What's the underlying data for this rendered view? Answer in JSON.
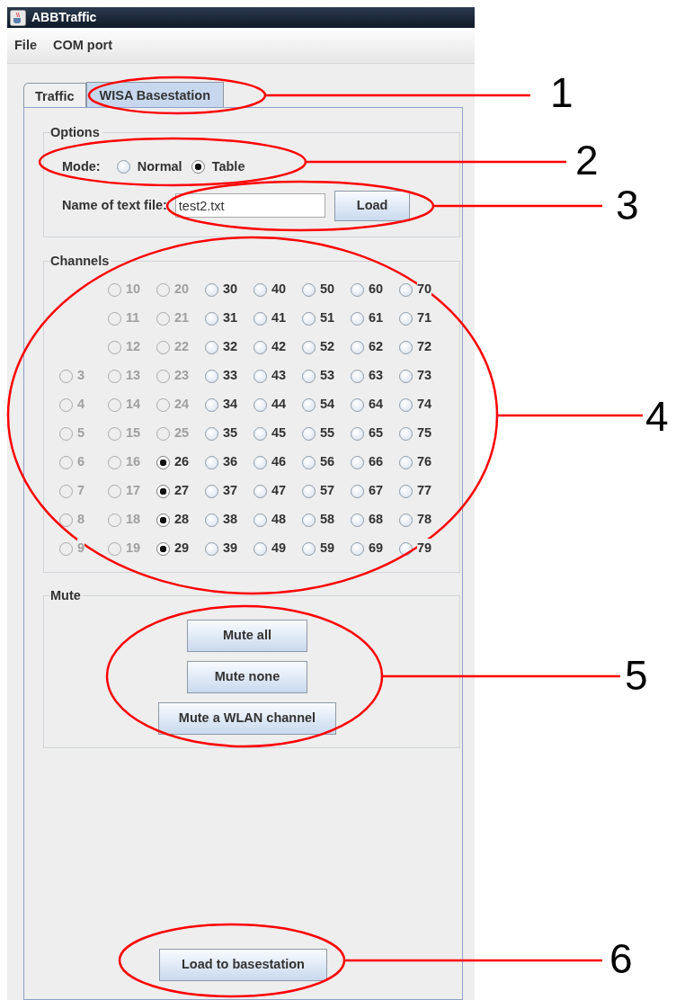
{
  "window": {
    "title": "ABBTraffic"
  },
  "menu": [
    {
      "label": "File"
    },
    {
      "label": "COM port"
    }
  ],
  "tabs": [
    {
      "label": "Traffic",
      "selected": false
    },
    {
      "label": "WISA Basestation",
      "selected": true
    }
  ],
  "options": {
    "title": "Options",
    "mode_label": "Mode:",
    "modes": [
      {
        "label": "Normal",
        "selected": false
      },
      {
        "label": "Table",
        "selected": true
      }
    ],
    "file_label": "Name of text file:",
    "file_value": "test2.txt",
    "load_button": "Load"
  },
  "channels": {
    "title": "Channels",
    "columns": [
      {
        "items": [
          {
            "label": "3",
            "selected": false,
            "disabled": true
          },
          {
            "label": "4",
            "selected": false,
            "disabled": true
          },
          {
            "label": "5",
            "selected": false,
            "disabled": true
          },
          {
            "label": "6",
            "selected": false,
            "disabled": true
          },
          {
            "label": "7",
            "selected": false,
            "disabled": true
          },
          {
            "label": "8",
            "selected": false,
            "disabled": true
          },
          {
            "label": "9",
            "selected": false,
            "disabled": true
          }
        ]
      },
      {
        "items": [
          {
            "label": "10",
            "selected": false,
            "disabled": true
          },
          {
            "label": "11",
            "selected": false,
            "disabled": true
          },
          {
            "label": "12",
            "selected": false,
            "disabled": true
          },
          {
            "label": "13",
            "selected": false,
            "disabled": true
          },
          {
            "label": "14",
            "selected": false,
            "disabled": true
          },
          {
            "label": "15",
            "selected": false,
            "disabled": true
          },
          {
            "label": "16",
            "selected": false,
            "disabled": true
          },
          {
            "label": "17",
            "selected": false,
            "disabled": true
          },
          {
            "label": "18",
            "selected": false,
            "disabled": true
          },
          {
            "label": "19",
            "selected": false,
            "disabled": true
          }
        ]
      },
      {
        "items": [
          {
            "label": "20",
            "selected": false,
            "disabled": true
          },
          {
            "label": "21",
            "selected": false,
            "disabled": true
          },
          {
            "label": "22",
            "selected": false,
            "disabled": true
          },
          {
            "label": "23",
            "selected": false,
            "disabled": true
          },
          {
            "label": "24",
            "selected": false,
            "disabled": true
          },
          {
            "label": "25",
            "selected": false,
            "disabled": true
          },
          {
            "label": "26",
            "selected": true,
            "disabled": false
          },
          {
            "label": "27",
            "selected": true,
            "disabled": false
          },
          {
            "label": "28",
            "selected": true,
            "disabled": false
          },
          {
            "label": "29",
            "selected": true,
            "disabled": false
          }
        ]
      },
      {
        "items": [
          {
            "label": "30",
            "selected": false,
            "disabled": false
          },
          {
            "label": "31",
            "selected": false,
            "disabled": false
          },
          {
            "label": "32",
            "selected": false,
            "disabled": false
          },
          {
            "label": "33",
            "selected": false,
            "disabled": false
          },
          {
            "label": "34",
            "selected": false,
            "disabled": false
          },
          {
            "label": "35",
            "selected": false,
            "disabled": false
          },
          {
            "label": "36",
            "selected": false,
            "disabled": false
          },
          {
            "label": "37",
            "selected": false,
            "disabled": false
          },
          {
            "label": "38",
            "selected": false,
            "disabled": false
          },
          {
            "label": "39",
            "selected": false,
            "disabled": false
          }
        ]
      },
      {
        "items": [
          {
            "label": "40",
            "selected": false,
            "disabled": false
          },
          {
            "label": "41",
            "selected": false,
            "disabled": false
          },
          {
            "label": "42",
            "selected": false,
            "disabled": false
          },
          {
            "label": "43",
            "selected": false,
            "disabled": false
          },
          {
            "label": "44",
            "selected": false,
            "disabled": false
          },
          {
            "label": "45",
            "selected": false,
            "disabled": false
          },
          {
            "label": "46",
            "selected": false,
            "disabled": false
          },
          {
            "label": "47",
            "selected": false,
            "disabled": false
          },
          {
            "label": "48",
            "selected": false,
            "disabled": false
          },
          {
            "label": "49",
            "selected": false,
            "disabled": false
          }
        ]
      },
      {
        "items": [
          {
            "label": "50",
            "selected": false,
            "disabled": false
          },
          {
            "label": "51",
            "selected": false,
            "disabled": false
          },
          {
            "label": "52",
            "selected": false,
            "disabled": false
          },
          {
            "label": "53",
            "selected": false,
            "disabled": false
          },
          {
            "label": "54",
            "selected": false,
            "disabled": false
          },
          {
            "label": "55",
            "selected": false,
            "disabled": false
          },
          {
            "label": "56",
            "selected": false,
            "disabled": false
          },
          {
            "label": "57",
            "selected": false,
            "disabled": false
          },
          {
            "label": "58",
            "selected": false,
            "disabled": false
          },
          {
            "label": "59",
            "selected": false,
            "disabled": false
          }
        ]
      },
      {
        "items": [
          {
            "label": "60",
            "selected": false,
            "disabled": false
          },
          {
            "label": "61",
            "selected": false,
            "disabled": false
          },
          {
            "label": "62",
            "selected": false,
            "disabled": false
          },
          {
            "label": "63",
            "selected": false,
            "disabled": false
          },
          {
            "label": "64",
            "selected": false,
            "disabled": false
          },
          {
            "label": "65",
            "selected": false,
            "disabled": false
          },
          {
            "label": "66",
            "selected": false,
            "disabled": false
          },
          {
            "label": "67",
            "selected": false,
            "disabled": false
          },
          {
            "label": "68",
            "selected": false,
            "disabled": false
          },
          {
            "label": "69",
            "selected": false,
            "disabled": false
          }
        ]
      },
      {
        "items": [
          {
            "label": "70",
            "selected": false,
            "disabled": false
          },
          {
            "label": "71",
            "selected": false,
            "disabled": false
          },
          {
            "label": "72",
            "selected": false,
            "disabled": false
          },
          {
            "label": "73",
            "selected": false,
            "disabled": false
          },
          {
            "label": "74",
            "selected": false,
            "disabled": false
          },
          {
            "label": "75",
            "selected": false,
            "disabled": false
          },
          {
            "label": "76",
            "selected": false,
            "disabled": false
          },
          {
            "label": "77",
            "selected": false,
            "disabled": false
          },
          {
            "label": "78",
            "selected": false,
            "disabled": false
          },
          {
            "label": "79",
            "selected": false,
            "disabled": false
          }
        ]
      }
    ]
  },
  "mute": {
    "title": "Mute",
    "buttons": [
      {
        "label": "Mute all"
      },
      {
        "label": "Mute none"
      },
      {
        "label": "Mute a WLAN channel"
      }
    ]
  },
  "footer_button": {
    "label": "Load to basestation"
  },
  "callouts": [
    {
      "number": "1"
    },
    {
      "number": "2"
    },
    {
      "number": "3"
    },
    {
      "number": "4"
    },
    {
      "number": "5"
    },
    {
      "number": "6"
    }
  ]
}
